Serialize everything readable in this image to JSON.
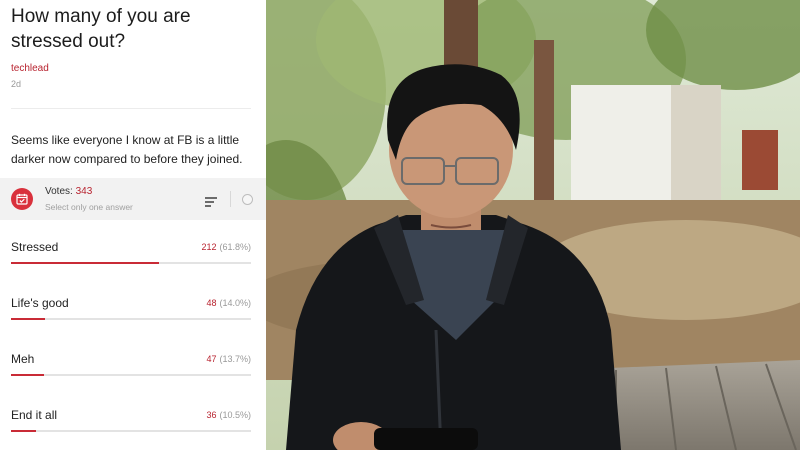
{
  "post": {
    "title": "How many of you are stressed out?",
    "author": "techlead",
    "time_ago": "2d",
    "body": "Seems like everyone I know at FB is a little darker now compared to before they joined."
  },
  "poll": {
    "votes_label": "Votes:",
    "votes_count": "343",
    "hint": "Select only one answer",
    "icon": "calendar-check-icon",
    "options": [
      {
        "label": "Stressed",
        "count": "212",
        "percent_text": "(61.8%)",
        "fraction": 0.618
      },
      {
        "label": "Life's good",
        "count": "48",
        "percent_text": "(14.0%)",
        "fraction": 0.14
      },
      {
        "label": "Meh",
        "count": "47",
        "percent_text": "(13.7%)",
        "fraction": 0.137
      },
      {
        "label": "End it all",
        "count": "36",
        "percent_text": "(10.5%)",
        "fraction": 0.105
      }
    ]
  },
  "colors": {
    "accent": "#c92b36",
    "accent_text": "#b8232f",
    "muted": "#999999"
  }
}
